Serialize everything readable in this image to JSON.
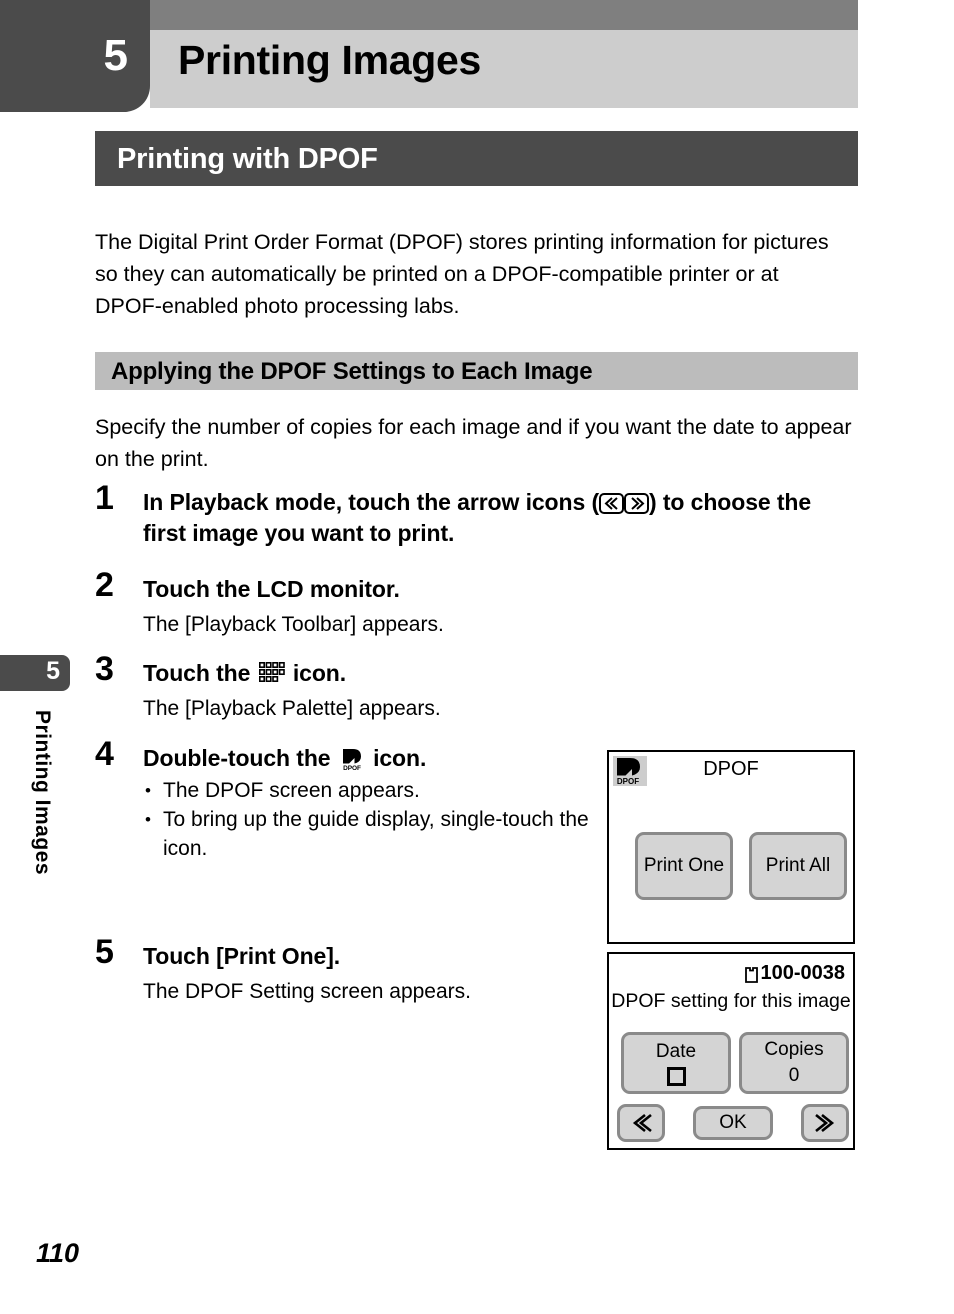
{
  "chapter": {
    "number": "5",
    "title": "Printing Images"
  },
  "section": {
    "title": "Printing with DPOF"
  },
  "intro_paragraph": "The Digital Print Order Format (DPOF) stores printing information for pictures so they can automatically be printed on a DPOF-compatible printer or at DPOF-enabled photo processing labs.",
  "subsection": {
    "title": "Applying the DPOF Settings to Each Image"
  },
  "lead_paragraph": "Specify the number of copies for each image and if you want the date to appear on the print.",
  "steps": [
    {
      "number": "1",
      "title_before": "In Playback mode, touch the arrow icons (",
      "title_after": ") to choose the first image you want to print.",
      "icons": [
        "arrow-left-icon",
        "arrow-right-icon"
      ]
    },
    {
      "number": "2",
      "title": "Touch the LCD monitor.",
      "sub": "The [Playback Toolbar] appears."
    },
    {
      "number": "3",
      "title_before": "Touch the ",
      "title_after": " icon.",
      "icon": "mode-palette-icon",
      "sub": "The [Playback Palette] appears."
    },
    {
      "number": "4",
      "title_before": "Double-touch the ",
      "title_after": " icon.",
      "icon": "dpof-icon",
      "bullets": [
        "The DPOF screen appears.",
        "To bring up the guide display, single-touch the icon."
      ]
    },
    {
      "number": "5",
      "title": "Touch [Print One].",
      "sub": "The DPOF Setting screen appears."
    }
  ],
  "lcd_dpof": {
    "title": "DPOF",
    "badge_label": "DPOF",
    "buttons": [
      {
        "label": "Print One"
      },
      {
        "label": "Print All"
      }
    ]
  },
  "lcd_setting": {
    "file_number": "100-0038",
    "caption": "DPOF setting for this image",
    "date_label": "Date",
    "date_value": "",
    "copies_label": "Copies",
    "copies_value": "0",
    "ok_label": "OK",
    "prev_label": "prev-icon",
    "next_label": "next-icon"
  },
  "side_tab": {
    "number": "5",
    "label": "Printing Images"
  },
  "page_number": "110",
  "colors": {
    "dark": "#4b4b4b",
    "header_band": "#7f7f7f",
    "header_light": "#cdcdcd",
    "subsection_gray": "#bcbcbc",
    "button_face": "#d4d4d4",
    "button_edge": "#8a8a8a"
  }
}
